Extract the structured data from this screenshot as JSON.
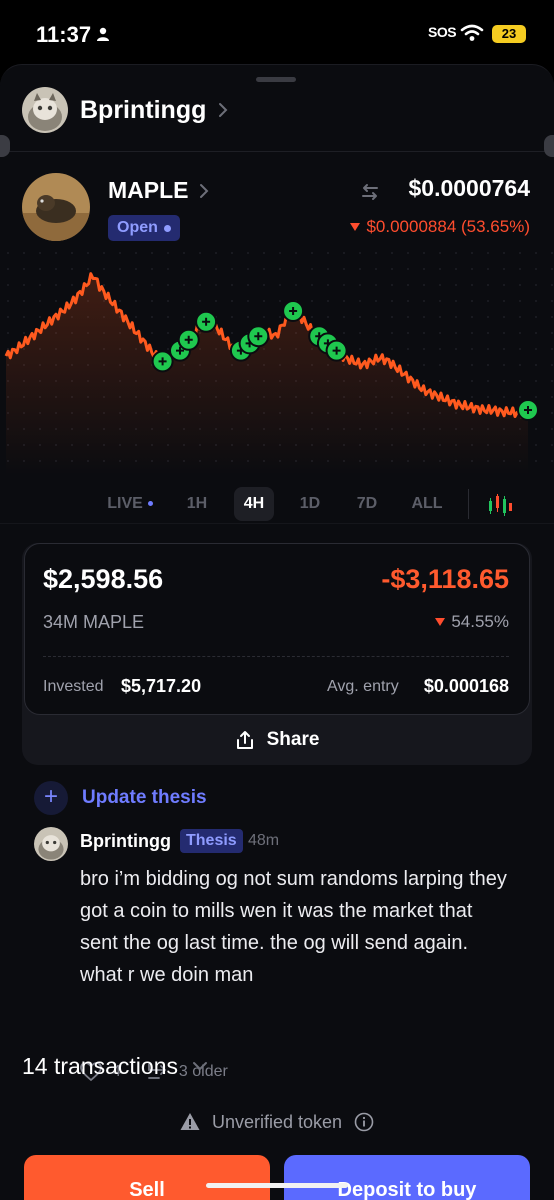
{
  "status_bar": {
    "time": "11:37",
    "carrier": "SOS",
    "battery": "23",
    "icons": [
      "person-icon",
      "wifi-icon"
    ]
  },
  "user": {
    "name": "Bprintingg"
  },
  "token": {
    "symbol": "MAPLE",
    "status": "Open",
    "price": "$0.0000764",
    "change": "$0.0000884 (53.65%)",
    "change_color": "#ff4d2e"
  },
  "timeframes": {
    "items": [
      "LIVE",
      "1H",
      "4H",
      "1D",
      "7D",
      "ALL"
    ],
    "active": "4H"
  },
  "chart_data": {
    "type": "line",
    "color": "#ff5a1f",
    "x": [
      0,
      1,
      2,
      3,
      4,
      5,
      6,
      7,
      8,
      9,
      10,
      11,
      12,
      13,
      14,
      15,
      16,
      17,
      18,
      19,
      20,
      21,
      22,
      23,
      24,
      25,
      26,
      27,
      28,
      29,
      30,
      31,
      32,
      33,
      34,
      35,
      36,
      37,
      38,
      39,
      40,
      41,
      42,
      43,
      44,
      45,
      46,
      47,
      48,
      49,
      50,
      51,
      52,
      53,
      54,
      55,
      56,
      57,
      58,
      59,
      60
    ],
    "values": [
      0.55,
      0.58,
      0.62,
      0.66,
      0.7,
      0.74,
      0.78,
      0.82,
      0.87,
      0.93,
      1.0,
      0.92,
      0.86,
      0.8,
      0.74,
      0.68,
      0.62,
      0.56,
      0.52,
      0.54,
      0.58,
      0.64,
      0.7,
      0.74,
      0.72,
      0.66,
      0.6,
      0.58,
      0.62,
      0.66,
      0.68,
      0.66,
      0.74,
      0.8,
      0.76,
      0.7,
      0.66,
      0.62,
      0.58,
      0.54,
      0.52,
      0.5,
      0.52,
      0.54,
      0.52,
      0.48,
      0.44,
      0.4,
      0.36,
      0.34,
      0.32,
      0.3,
      0.28,
      0.27,
      0.26,
      0.25,
      0.25,
      0.24,
      0.24,
      0.23,
      0.25
    ],
    "buy_markers": [
      18,
      20,
      21,
      23,
      27,
      28,
      29,
      33,
      36,
      37,
      38,
      60
    ],
    "grid": false,
    "legend": "none"
  },
  "position": {
    "value": "$2,598.56",
    "holding": "34M MAPLE",
    "pnl": "-$3,118.65",
    "pnl_pct": "54.55%",
    "invested_label": "Invested",
    "invested": "$5,717.20",
    "avg_entry_label": "Avg. entry",
    "avg_entry": "$0.000168",
    "share_label": "Share",
    "loss_color": "#ff5a2e"
  },
  "thesis": {
    "update_label": "Update thesis",
    "comment": {
      "author": "Bprintingg",
      "badge": "Thesis",
      "time": "48m",
      "body": "bro i’m bidding og not sum randoms larping they got a coin to mills wen it was the market that sent the og last time. the og will send again. what r we doin man",
      "likes": "4",
      "older": "3 older"
    }
  },
  "transactions": {
    "label": "14 transactions"
  },
  "warning": {
    "label": "Unverified token"
  },
  "actions": {
    "sell": "Sell",
    "deposit": "Deposit to buy",
    "sell_color": "#ff5a2e",
    "deposit_color": "#5b6aff"
  }
}
